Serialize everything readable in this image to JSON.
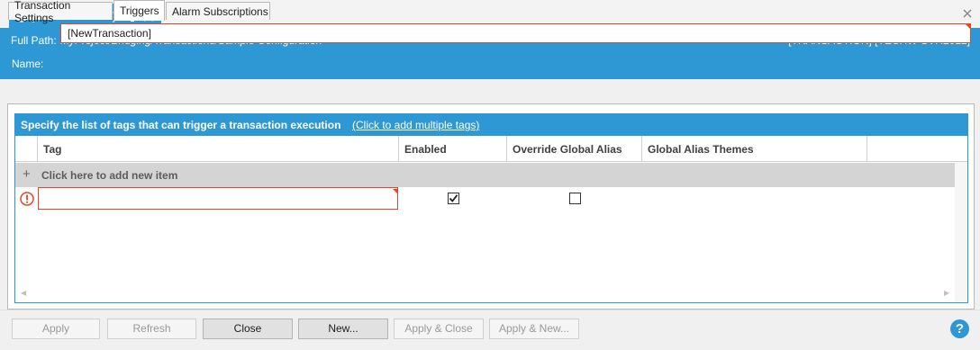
{
  "document_tab": {
    "title": "[NewTransaction] *",
    "status_icon": "refresh-icon",
    "pin_icon": "pin-icon",
    "close_icon": "close-icon"
  },
  "window": {
    "close_icon": "close-icon"
  },
  "header": {
    "full_path_label": "Full Path:",
    "full_path_value": "MyProject/Bridging/Transactions/Sample Configuration",
    "server": "[TRANSACTION] [TECHW-SVR2012]",
    "name_label": "Name:",
    "name_value": "[NewTransaction]"
  },
  "tabs": [
    {
      "label": "Transaction Settings",
      "active": false
    },
    {
      "label": "Triggers",
      "active": true
    },
    {
      "label": "Alarm Subscriptions",
      "active": false
    }
  ],
  "grid": {
    "hint": "Specify the list of tags that can trigger a transaction execution",
    "link": "(Click to add multiple tags)",
    "columns": [
      "Tag",
      "Enabled",
      "Override Global Alias",
      "Global Alias Themes"
    ],
    "add_row": "Click here to add new item",
    "rows": [
      {
        "tag": "",
        "enabled": true,
        "override_global_alias": false,
        "global_alias_themes": "",
        "has_error": true
      }
    ]
  },
  "buttons": {
    "apply": "Apply",
    "refresh": "Refresh",
    "close": "Close",
    "new": "New...",
    "apply_close": "Apply & Close",
    "apply_new": "Apply & New...",
    "help": "?"
  },
  "colors": {
    "accent": "#2e98d5",
    "error": "#e3452b"
  }
}
